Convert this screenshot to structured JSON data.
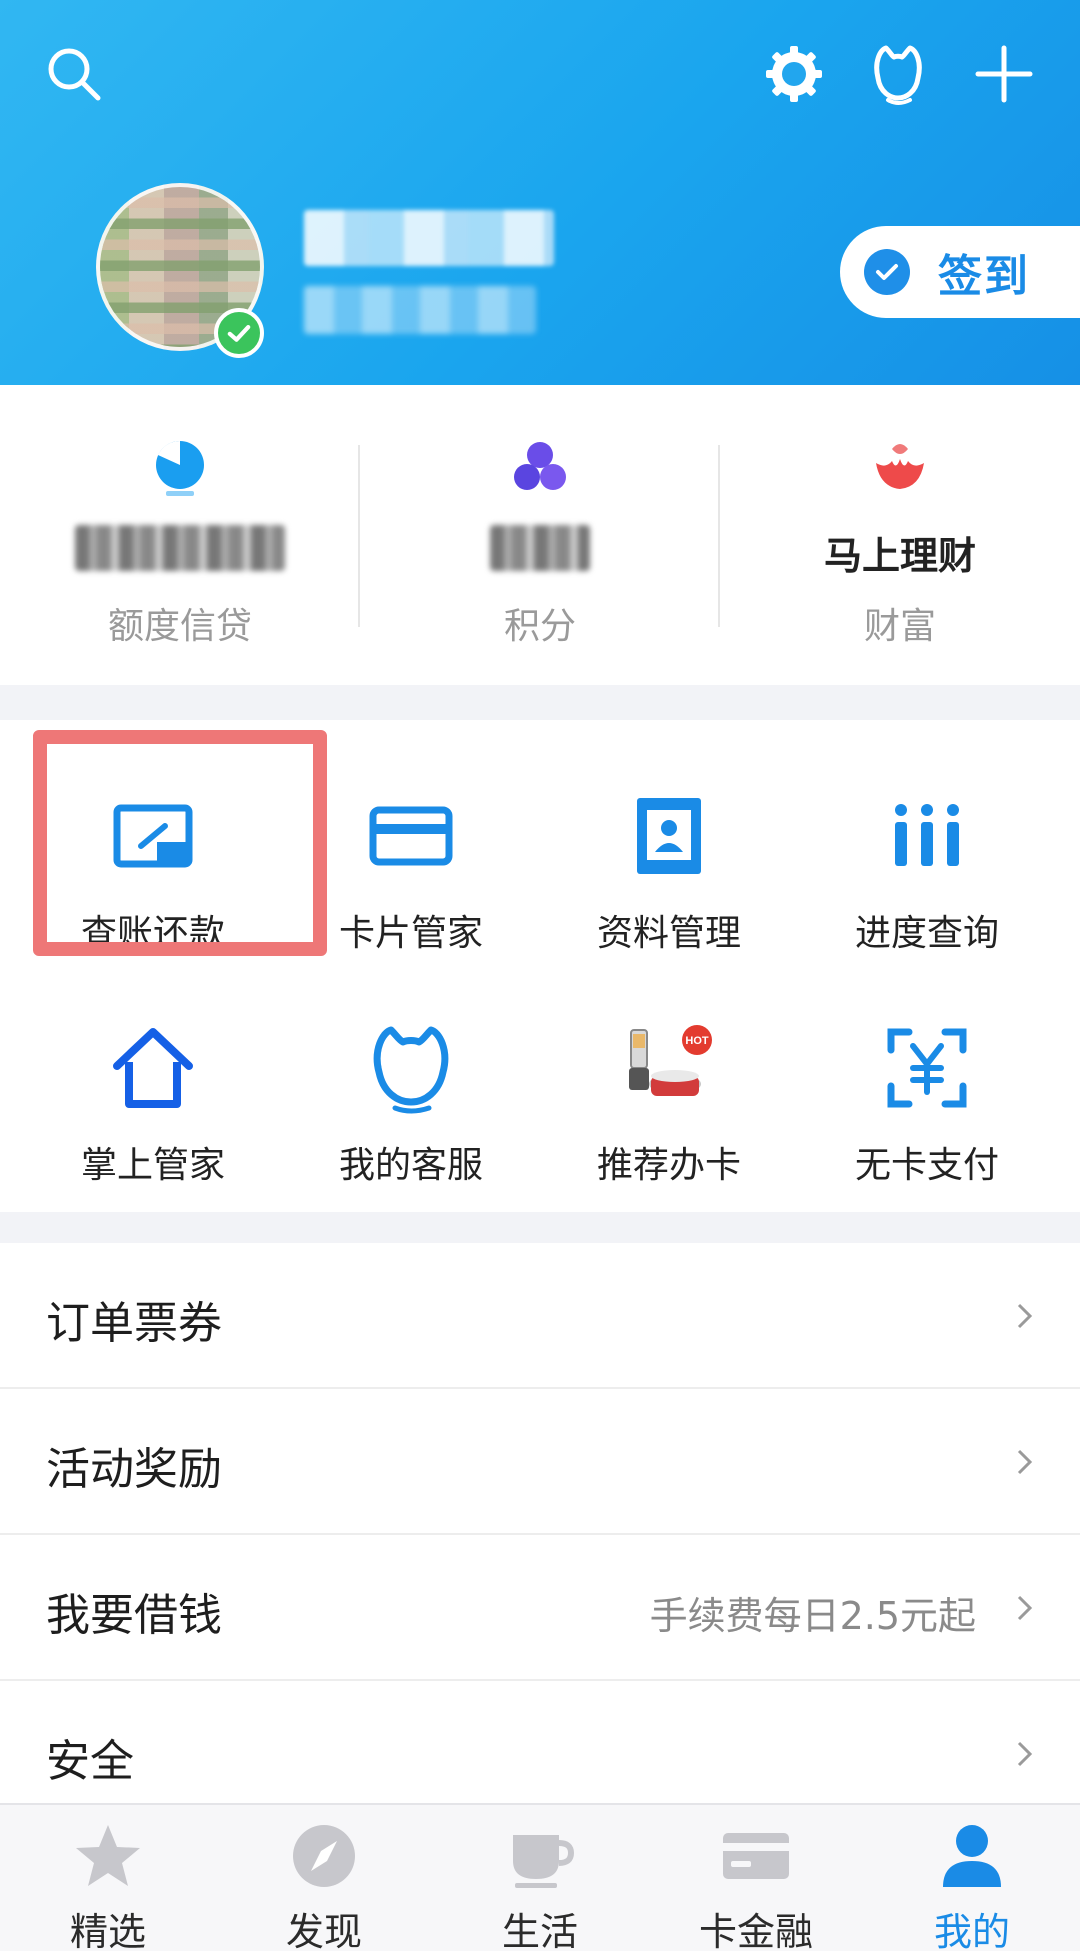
{
  "header": {
    "signin_label": "签到"
  },
  "stats": [
    {
      "label": "额度信贷",
      "value": ""
    },
    {
      "label": "积分",
      "value": ""
    },
    {
      "label": "财富",
      "value": "马上理财"
    }
  ],
  "grid": [
    {
      "label": "查账还款"
    },
    {
      "label": "卡片管家"
    },
    {
      "label": "资料管理"
    },
    {
      "label": "进度查询"
    },
    {
      "label": "掌上管家"
    },
    {
      "label": "我的客服"
    },
    {
      "label": "推荐办卡"
    },
    {
      "label": "无卡支付"
    }
  ],
  "list": [
    {
      "label": "订单票券",
      "note": ""
    },
    {
      "label": "活动奖励",
      "note": ""
    },
    {
      "label": "我要借钱",
      "note": "手续费每日2.5元起"
    },
    {
      "label": "安全",
      "note": ""
    }
  ],
  "tabs": [
    {
      "label": "精选"
    },
    {
      "label": "发现"
    },
    {
      "label": "生活"
    },
    {
      "label": "卡金融"
    },
    {
      "label": "我的"
    }
  ],
  "badges": {
    "hot": "HOT"
  },
  "colors": {
    "accent": "#1a8be6",
    "header_gradient_start": "#31b7f2",
    "header_gradient_end": "#1690e6",
    "highlight": "#ee7777",
    "verified": "#3bc45c",
    "wealth_red": "#ee4a4a",
    "points_purple": "#6a4de8"
  },
  "icons": {
    "header": [
      "search-icon",
      "settings-icon",
      "service-icon",
      "add-icon"
    ],
    "stats": [
      "credit-limit-icon",
      "points-icon",
      "wealth-icon"
    ],
    "grid": [
      "bill-repay-icon",
      "card-manager-icon",
      "profile-manage-icon",
      "progress-query-icon",
      "home-manager-icon",
      "customer-service-icon",
      "recommend-card-icon",
      "cardless-pay-icon"
    ],
    "tabs": [
      "star-icon",
      "compass-icon",
      "cup-icon",
      "card-icon",
      "person-icon"
    ]
  }
}
